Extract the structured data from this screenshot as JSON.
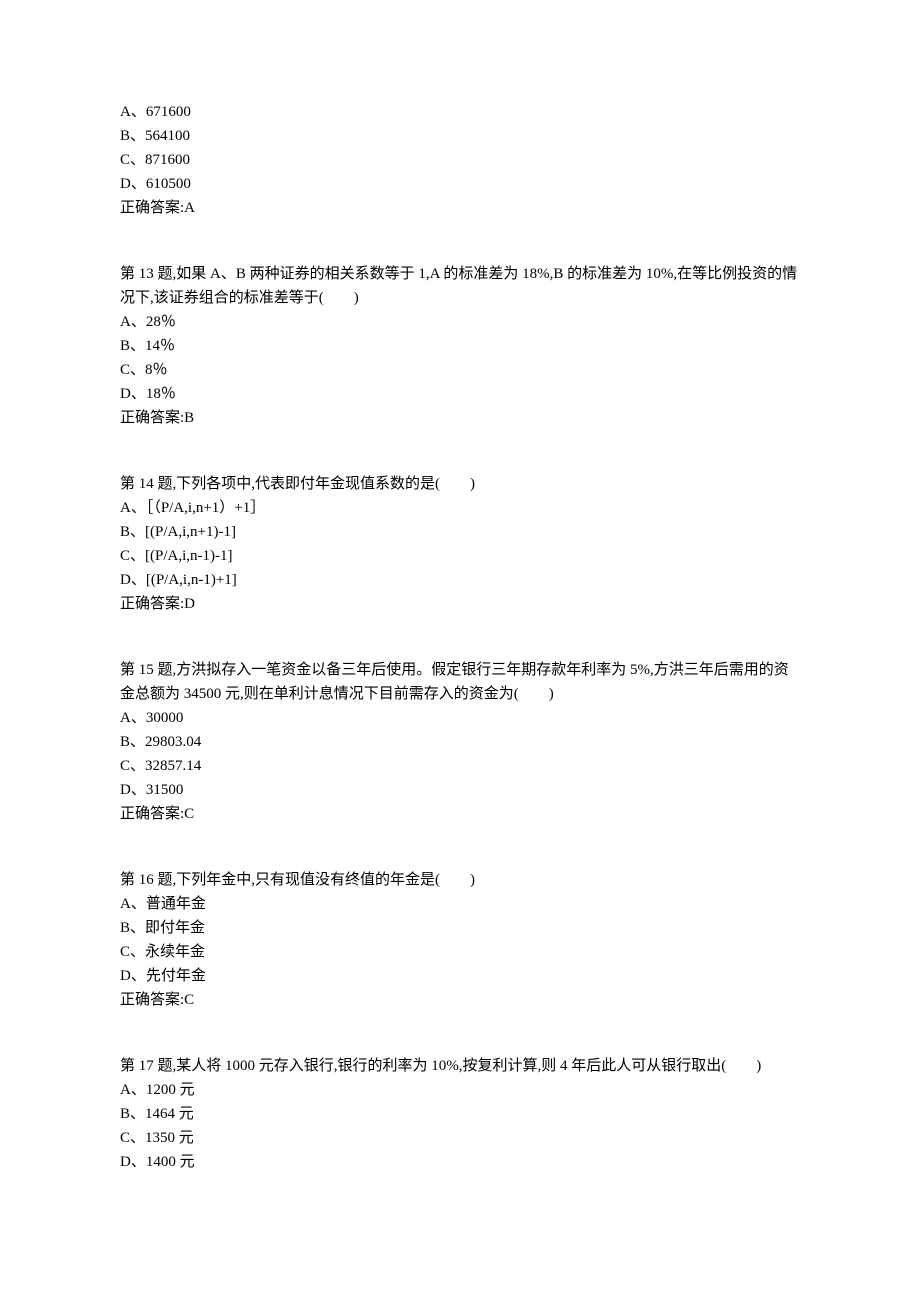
{
  "q12_options": {
    "a": "A、671600",
    "b": "B、564100",
    "c": "C、871600",
    "d": "D、610500",
    "answer": "正确答案:A"
  },
  "q13": {
    "text": "第 13 题,如果 A、B 两种证券的相关系数等于 1,A 的标准差为 18%,B 的标准差为 10%,在等比例投资的情况下,该证券组合的标准差等于(　　)",
    "a": "A、28％",
    "b": "B、14％",
    "c": "C、8％",
    "d": "D、18％",
    "answer": "正确答案:B"
  },
  "q14": {
    "text": "第 14 题,下列各项中,代表即付年金现值系数的是(　　)",
    "a": "A、［（P/A,i,n+1）+1］",
    "b": "B、[(P/A,i,n+1)-1]",
    "c": "C、[(P/A,i,n-1)-1]",
    "d": "D、[(P/A,i,n-1)+1]",
    "answer": "正确答案:D"
  },
  "q15": {
    "text": "第 15 题,方洪拟存入一笔资金以备三年后使用。假定银行三年期存款年利率为 5%,方洪三年后需用的资金总额为 34500 元,则在单利计息情况下目前需存入的资金为(　　)",
    "a": "A、30000",
    "b": "B、29803.04",
    "c": "C、32857.14",
    "d": "D、31500",
    "answer": "正确答案:C"
  },
  "q16": {
    "text": "第 16 题,下列年金中,只有现值没有终值的年金是(　　)",
    "a": "A、普通年金",
    "b": "B、即付年金",
    "c": "C、永续年金",
    "d": "D、先付年金",
    "answer": "正确答案:C"
  },
  "q17": {
    "text": "第 17 题,某人将 1000 元存入银行,银行的利率为 10%,按复利计算,则 4 年后此人可从银行取出(　　)",
    "a": "A、1200 元",
    "b": "B、1464 元",
    "c": "C、1350 元",
    "d": "D、1400 元"
  }
}
